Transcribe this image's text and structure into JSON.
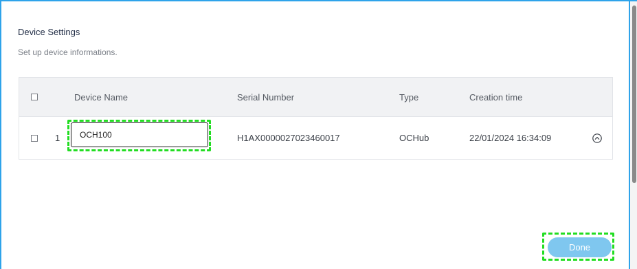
{
  "dialog": {
    "title": "Device Settings",
    "subtitle": "Set up device informations."
  },
  "table": {
    "columns": {
      "device_name": "Device Name",
      "serial_number": "Serial Number",
      "type": "Type",
      "creation_time": "Creation time"
    },
    "rows": [
      {
        "index": "1",
        "device_name": "OCH100",
        "serial_number": "H1AX0000027023460017",
        "type": "OCHub",
        "creation_time": "22/01/2024 16:34:09",
        "checked": false
      }
    ],
    "select_all_checked": false
  },
  "footer": {
    "done_label": "Done"
  },
  "colors": {
    "accent_border": "#2ea3ea",
    "done_button": "#7fc7ef",
    "highlight": "#22dd22"
  }
}
